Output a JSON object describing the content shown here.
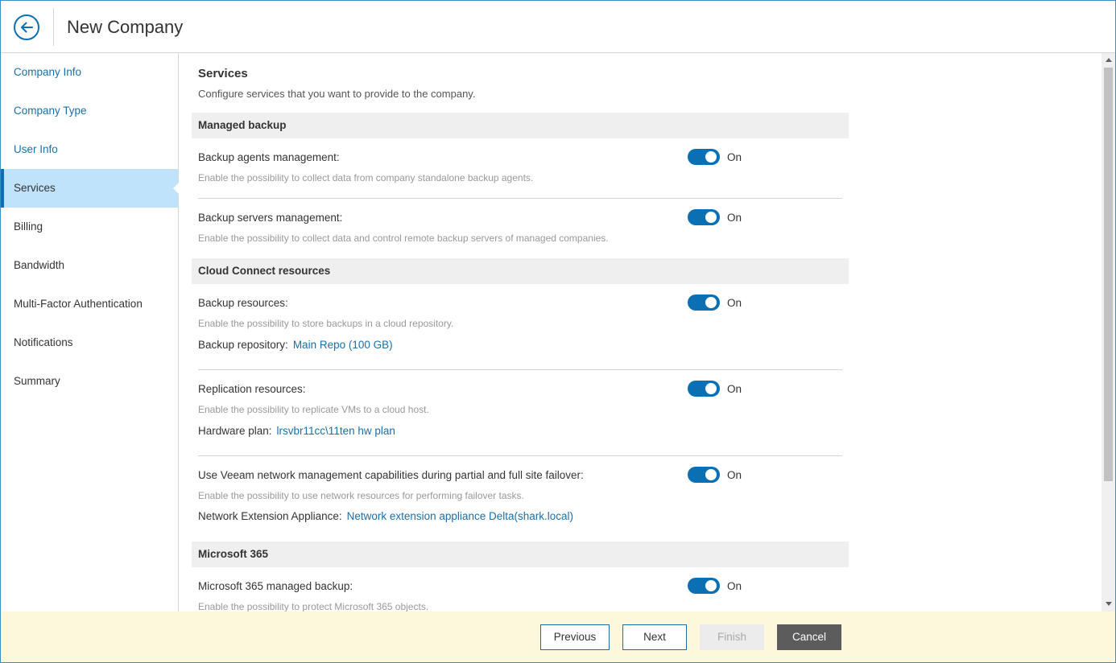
{
  "header": {
    "title": "New Company"
  },
  "sidebar": {
    "items": [
      {
        "label": "Company Info"
      },
      {
        "label": "Company Type"
      },
      {
        "label": "User Info"
      },
      {
        "label": "Services"
      },
      {
        "label": "Billing"
      },
      {
        "label": "Bandwidth"
      },
      {
        "label": "Multi-Factor Authentication"
      },
      {
        "label": "Notifications"
      },
      {
        "label": "Summary"
      }
    ],
    "active_index": 3
  },
  "page": {
    "title": "Services",
    "subtitle": "Configure services that you want to provide to the company."
  },
  "sections": {
    "managed_backup": {
      "title": "Managed backup",
      "agents": {
        "label": "Backup agents management:",
        "description": "Enable the possibility to collect data from company standalone backup agents.",
        "toggle": "On"
      },
      "servers": {
        "label": "Backup servers management:",
        "description": "Enable the possibility to collect data and control remote backup servers of managed companies.",
        "toggle": "On"
      }
    },
    "cloud_connect": {
      "title": "Cloud Connect resources",
      "backup_resources": {
        "label": "Backup resources:",
        "description": "Enable the possibility to store backups in a cloud repository.",
        "toggle": "On",
        "extra_label": "Backup repository:",
        "extra_value": "Main Repo (100 GB)"
      },
      "replication_resources": {
        "label": "Replication resources:",
        "description": "Enable the possibility to replicate VMs to a cloud host.",
        "toggle": "On",
        "extra_label": "Hardware plan:",
        "extra_value": "lrsvbr11cc\\11ten hw plan"
      },
      "network": {
        "label": "Use Veeam network management capabilities during partial and full site failover:",
        "description": "Enable the possibility to use network resources for performing failover tasks.",
        "toggle": "On",
        "extra_label": "Network Extension Appliance:",
        "extra_value": "Network extension appliance Delta(shark.local)"
      }
    },
    "microsoft_365": {
      "title": "Microsoft 365",
      "managed_backup": {
        "label": "Microsoft 365 managed backup:",
        "description": "Enable the possibility to protect Microsoft 365 objects.",
        "toggle": "On"
      }
    }
  },
  "footer": {
    "previous": "Previous",
    "next": "Next",
    "finish": "Finish",
    "cancel": "Cancel"
  },
  "colors": {
    "accent": "#0a6fb3",
    "link": "#1a6fa8",
    "active_nav_bg": "#bfe3fb",
    "footer_bg": "#fdf8dc",
    "section_bg": "#efefef"
  }
}
